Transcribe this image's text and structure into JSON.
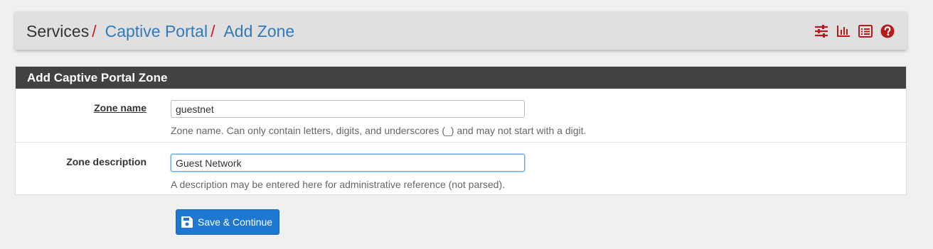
{
  "breadcrumb": {
    "root": "Services",
    "separator": "/",
    "items": [
      "Captive Portal",
      "Add Zone"
    ]
  },
  "header_icons": [
    "settings-sliders-icon",
    "bar-chart-icon",
    "list-icon",
    "help-icon"
  ],
  "panel": {
    "title": "Add Captive Portal Zone",
    "fields": [
      {
        "label": "Zone name",
        "value": "guestnet",
        "help": "Zone name. Can only contain letters, digits, and underscores (_) and may not start with a digit."
      },
      {
        "label": "Zone description",
        "value": "Guest Network",
        "help": "A description may be entered here for administrative reference (not parsed)."
      }
    ]
  },
  "save_button": {
    "label": "Save & Continue",
    "icon": "floppy-disk-icon"
  },
  "colors": {
    "accent": "#337ab7",
    "separator": "#cc2222",
    "icon": "#b71c1c",
    "panel_heading": "#424242",
    "button": "#1e78d2"
  }
}
